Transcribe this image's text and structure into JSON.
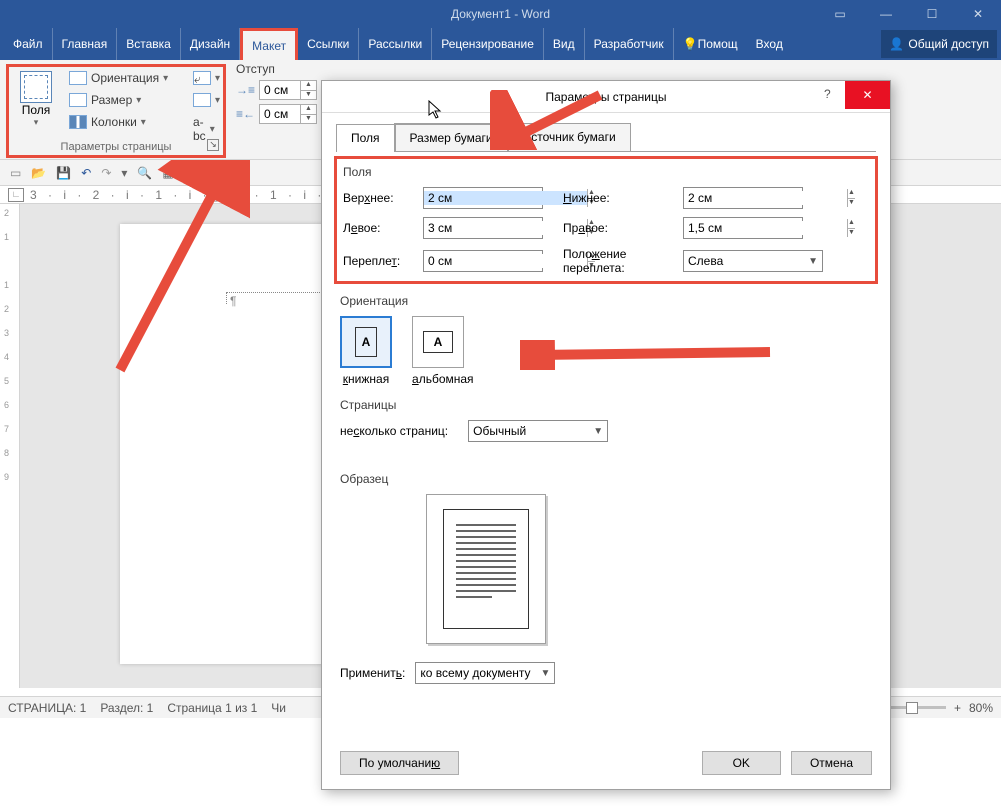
{
  "title": "Документ1 - Word",
  "ribbon": {
    "file": "Файл",
    "tabs": [
      "Главная",
      "Вставка",
      "Дизайн",
      "Макет",
      "Ссылки",
      "Рассылки",
      "Рецензирование",
      "Вид",
      "Разработчик"
    ],
    "active_index": 3,
    "help": "Помощ",
    "signin": "Вход",
    "share": "Общий доступ"
  },
  "page_setup_group": {
    "fields_btn": "Поля",
    "orientation": "Ориентация",
    "size": "Размер",
    "columns": "Колонки",
    "label": "Параметры страницы"
  },
  "indent": {
    "label": "Отступ",
    "left": "0 см",
    "right": "0 см"
  },
  "ruler": "3 · і · 2 · і · 1 · і ·  ̲ · і · 1 · і · 2",
  "ruler_v": [
    "2",
    "1",
    "",
    "1",
    "2",
    "3",
    "4",
    "5",
    "6",
    "7",
    "8",
    "9"
  ],
  "status": {
    "page": "СТРАНИЦА: 1",
    "section": "Раздел: 1",
    "pages": "Страница 1 из 1",
    "words": "Чи",
    "zoom": "80%"
  },
  "dialog": {
    "title": "Параметры страницы",
    "tabs": [
      "Поля",
      "Размер бумаги",
      "Источник бумаги"
    ],
    "margins": {
      "label": "Поля",
      "top_label": "Верхнее:",
      "top": "2 см",
      "bottom_label": "Нижнее:",
      "bottom": "2 см",
      "left_label": "Левое:",
      "left": "3 см",
      "right_label": "Правое:",
      "right": "1,5 см",
      "gutter_label": "Переплет:",
      "gutter": "0 см",
      "gutter_pos_label": "Положение переплета:",
      "gutter_pos": "Слева"
    },
    "orientation": {
      "label": "Ориентация",
      "portrait": "книжная",
      "landscape": "альбомная"
    },
    "pages": {
      "label": "Страницы",
      "multi_label": "несколько страниц:",
      "multi_value": "Обычный"
    },
    "preview_label": "Образец",
    "apply_label": "Применить:",
    "apply_value": "ко всему документу",
    "default_btn": "По умолчанию",
    "ok": "OK",
    "cancel": "Отмена"
  }
}
